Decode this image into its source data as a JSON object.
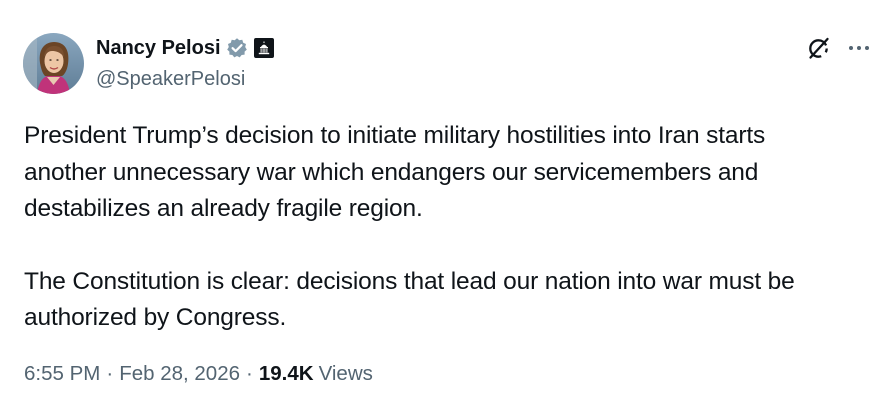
{
  "author": {
    "display_name": "Nancy Pelosi",
    "handle": "@SpeakerPelosi",
    "verified": true,
    "affiliation_badge": "government-building-icon"
  },
  "icons": {
    "verified": "verified-check-icon",
    "grok": "grok-slash-icon",
    "more": "more-dots-icon"
  },
  "colors": {
    "text_primary": "#0f1419",
    "text_secondary": "#536471",
    "verified_badge": "#829aab",
    "affiliation_badge_bg": "#0f1419"
  },
  "tweet": {
    "paragraphs": [
      "President Trump’s decision to initiate military hostilities into Iran starts\nanother unnecessary war which endangers our servicemembers and\ndestabilizes an already fragile region.",
      "The Constitution is clear: decisions that lead our nation into war must be\nauthorized by Congress."
    ]
  },
  "meta": {
    "time": "6:55 PM",
    "separator": "·",
    "date": "Feb 28, 2026",
    "views_count": "19.4K",
    "views_label": "Views"
  }
}
